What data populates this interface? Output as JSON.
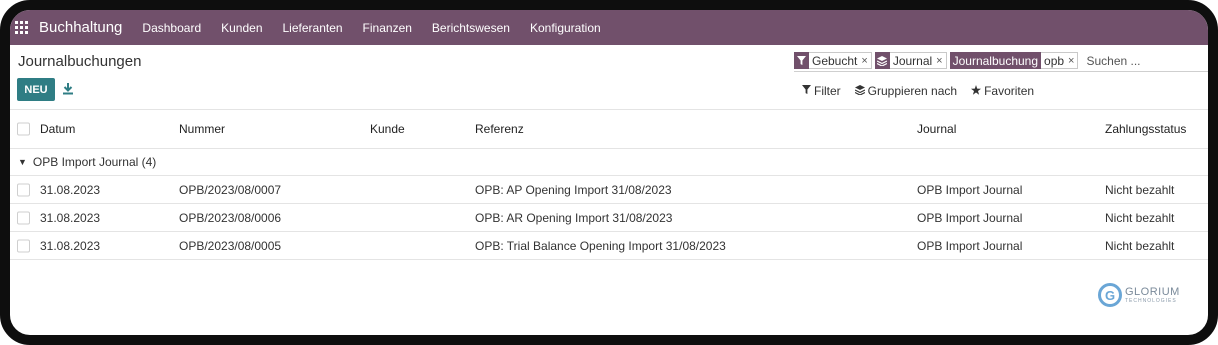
{
  "navbar": {
    "app_title": "Buchhaltung",
    "menu": [
      "Dashboard",
      "Kunden",
      "Lieferanten",
      "Finanzen",
      "Berichtswesen",
      "Konfiguration"
    ],
    "color": "#71506b"
  },
  "page": {
    "title": "Journalbuchungen",
    "new_button": "NEU"
  },
  "search": {
    "facets": {
      "status": {
        "icon": "filter-icon",
        "value": "Gebucht"
      },
      "groupby": {
        "icon": "layers-icon",
        "value": "Journal"
      },
      "journal": {
        "label": "Journalbuchung",
        "value": "opb"
      }
    },
    "close_glyph": "×",
    "placeholder": "Suchen ..."
  },
  "search_options": {
    "filter": "Filter",
    "group_by": "Gruppieren nach",
    "favorites": "Favoriten"
  },
  "table": {
    "columns": {
      "date": "Datum",
      "number": "Nummer",
      "customer": "Kunde",
      "reference": "Referenz",
      "journal": "Journal",
      "payment_status": "Zahlungsstatus"
    },
    "group": {
      "label": "OPB Import Journal (4)"
    },
    "rows": [
      {
        "date": "31.08.2023",
        "number": "OPB/2023/08/0007",
        "customer": "",
        "reference": "OPB: AP Opening Import 31/08/2023",
        "journal": "OPB Import Journal",
        "status": "Nicht bezahlt"
      },
      {
        "date": "31.08.2023",
        "number": "OPB/2023/08/0006",
        "customer": "",
        "reference": "OPB: AR Opening Import 31/08/2023",
        "journal": "OPB Import Journal",
        "status": "Nicht bezahlt"
      },
      {
        "date": "31.08.2023",
        "number": "OPB/2023/08/0005",
        "customer": "",
        "reference": "OPB: Trial Balance Opening Import 31/08/2023",
        "journal": "OPB Import Journal",
        "status": "Nicht bezahlt"
      }
    ]
  },
  "watermark": {
    "initial": "G",
    "name": "GLORIUM",
    "tagline": "TECHNOLOGIES"
  },
  "colors": {
    "accent": "#71506b",
    "primary_button": "#2f7d84"
  }
}
